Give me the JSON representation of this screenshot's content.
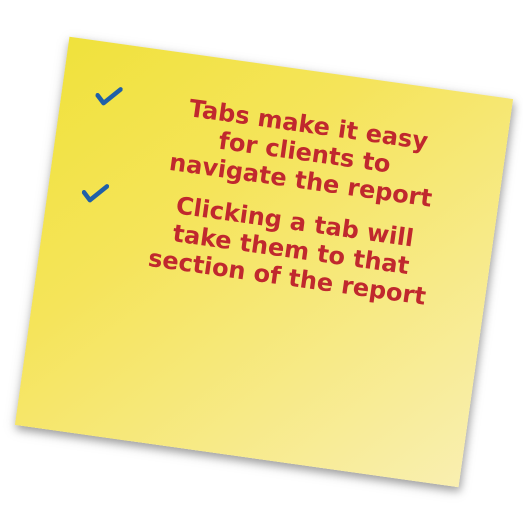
{
  "note": {
    "icon": "checkmark-icon",
    "colors": {
      "paper": "#f3e24a",
      "text": "#c0282e",
      "check": "#1f5fa8"
    },
    "bullets": [
      {
        "lines": [
          "Tabs make it easy",
          "for clients to",
          "navigate the report"
        ]
      },
      {
        "lines": [
          "Clicking a tab will",
          "take them to that",
          "section of the report"
        ]
      }
    ]
  }
}
